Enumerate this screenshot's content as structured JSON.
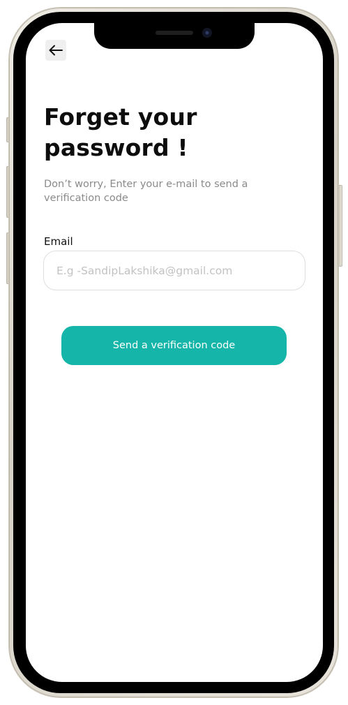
{
  "header": {
    "back_icon": "arrow-left-icon"
  },
  "main": {
    "title": "Forget your password !",
    "subtitle": "Don’t worry, Enter your e-mail to send a verification code",
    "email_label": "Email",
    "email_placeholder": "E.g -SandipLakshika@gmail.com",
    "email_value": "",
    "submit_label": "Send a verification code"
  },
  "colors": {
    "accent": "#15b5aa",
    "title": "#0d0d0d",
    "muted": "#8a8a8a",
    "input_border": "#dedede"
  }
}
